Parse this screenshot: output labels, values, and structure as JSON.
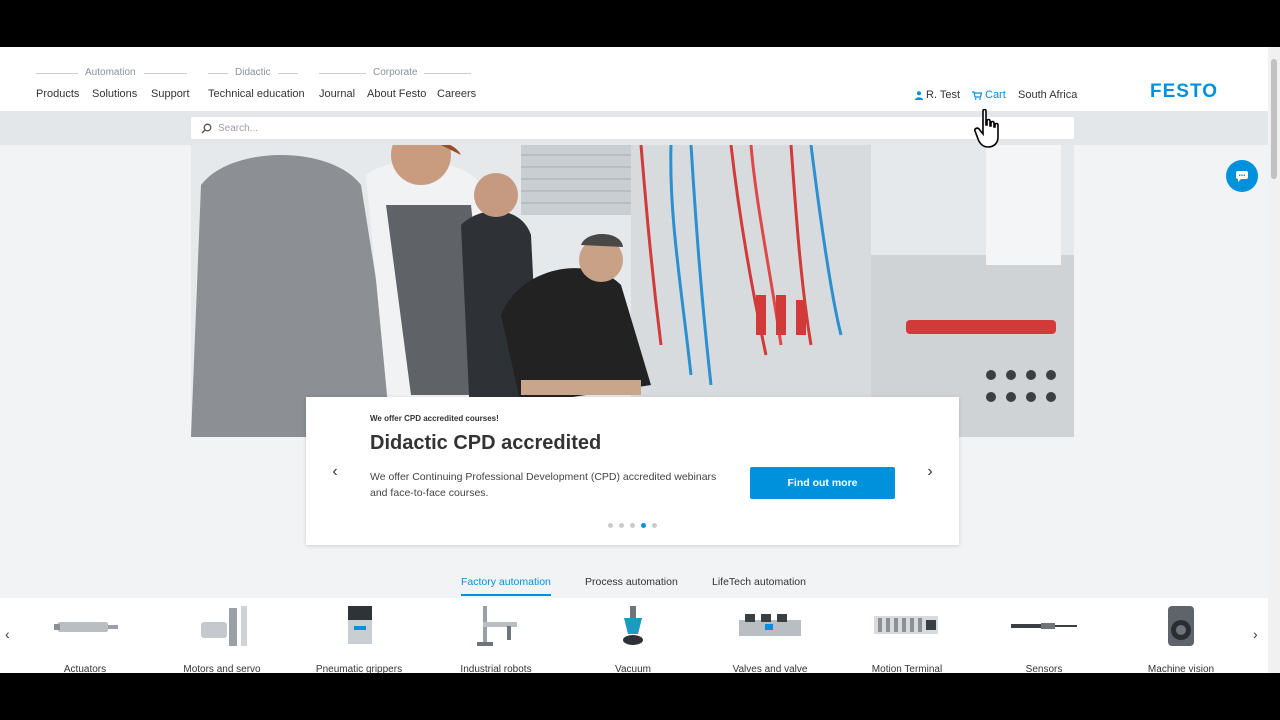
{
  "header": {
    "groups": [
      {
        "label": "Automation",
        "links": [
          "Products",
          "Solutions",
          "Support"
        ]
      },
      {
        "label": "Didactic",
        "links": [
          "Technical education"
        ]
      },
      {
        "label": "Corporate",
        "links": [
          "Journal",
          "About Festo",
          "Careers"
        ]
      }
    ],
    "user": "R. Test",
    "cart": "Cart",
    "region": "South Africa",
    "logo": "FESTO"
  },
  "search": {
    "placeholder": "Search..."
  },
  "hero": {
    "kicker": "We offer CPD accredited courses!",
    "title": "Didactic CPD accredited",
    "text": "We offer Continuing Professional Development (CPD) accredited webinars and face-to-face courses.",
    "cta": "Find out more",
    "slides_total": 5,
    "active_slide": 4
  },
  "tabs": [
    "Factory automation",
    "Process automation",
    "LifeTech automation"
  ],
  "active_tab": 0,
  "products": [
    "Actuators",
    "Motors and servo",
    "Pneumatic grippers",
    "Industrial robots",
    "Vacuum",
    "Valves and valve",
    "Motion Terminal",
    "Sensors",
    "Machine vision"
  ],
  "colors": {
    "brand": "#0091dc",
    "text": "#333333",
    "band": "#e4e7ea"
  },
  "icons": {
    "user": "user-icon",
    "cart": "cart-icon",
    "search": "search-icon",
    "chat": "chat-icon",
    "prev": "chevron-left-icon",
    "next": "chevron-right-icon"
  }
}
